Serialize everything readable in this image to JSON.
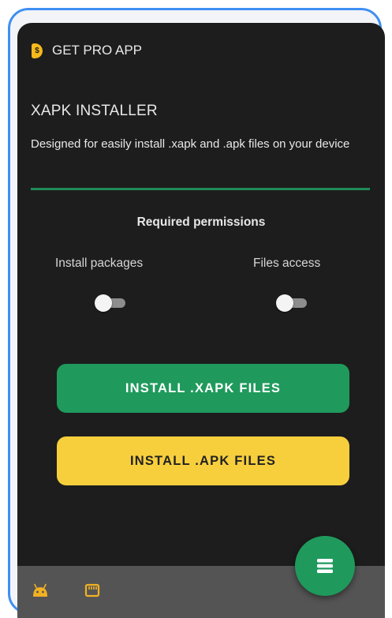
{
  "header": {
    "pro_icon": "pro-badge-icon",
    "pro_icon_glyph": "$",
    "pro_label": "GET PRO APP"
  },
  "app": {
    "title": "XAPK INSTALLER",
    "description": "Designed for easily install .xapk and .apk files on your device"
  },
  "permissions": {
    "title": "Required permissions",
    "items": [
      {
        "label": "Install packages",
        "enabled": false
      },
      {
        "label": "Files access",
        "enabled": false
      }
    ]
  },
  "actions": {
    "install_xapk_label": "INSTALL .XAPK FILES",
    "install_apk_label": "INSTALL .APK FILES"
  },
  "bottom_nav": {
    "left_icon": "android-icon",
    "right_icon": "sd-card-icon",
    "fab_icon": "menu-stack-icon"
  },
  "colors": {
    "background": "#1d1d1d",
    "accent_green": "#1f9a5c",
    "accent_yellow": "#f7cf3d",
    "divider": "#1f8a57",
    "bottom_bar": "#545454",
    "pro_icon": "#f5b91a",
    "frame_border": "#3f8ff2"
  }
}
